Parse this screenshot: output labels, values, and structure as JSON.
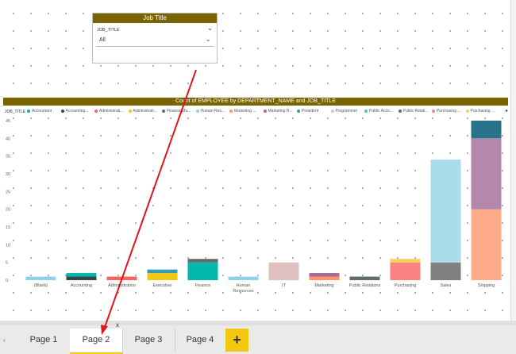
{
  "slicer": {
    "header": "Job Title",
    "field_label": "JOB_TITLE",
    "selected": "All"
  },
  "chart": {
    "header": "Count of EMPLOYEE by DEPARTMENT_NAME and JOB_TITLE",
    "legend_title": "JOB_TITLE",
    "legend_items": [
      {
        "label": "Accountant",
        "color": "#01b8aa"
      },
      {
        "label": "Accounting...",
        "color": "#374649"
      },
      {
        "label": "Administrati...",
        "color": "#fd625e"
      },
      {
        "label": "Administrati...",
        "color": "#f2c80f"
      },
      {
        "label": "Finance Ma...",
        "color": "#5f6b6d"
      },
      {
        "label": "Human Res...",
        "color": "#8ad4eb"
      },
      {
        "label": "Marketing ...",
        "color": "#fe9666"
      },
      {
        "label": "Marketing R...",
        "color": "#a66999"
      },
      {
        "label": "President",
        "color": "#3599b8"
      },
      {
        "label": "Programmer",
        "color": "#dfbfbf"
      },
      {
        "label": "Public Acco...",
        "color": "#4ac5bb"
      },
      {
        "label": "Public Relati...",
        "color": "#5f6b6d"
      },
      {
        "label": "Purchasing ...",
        "color": "#fb8281"
      },
      {
        "label": "Purchasing ...",
        "color": "#f4d25a"
      }
    ]
  },
  "chart_data": {
    "type": "bar",
    "stacked": true,
    "title": "Count of EMPLOYEE by DEPARTMENT_NAME and JOB_TITLE",
    "xlabel": "",
    "ylabel": "",
    "ylim": [
      0,
      45
    ],
    "yticks": [
      0,
      5,
      10,
      15,
      20,
      25,
      30,
      35,
      40,
      45
    ],
    "categories": [
      "(Blank)",
      "Accounting",
      "Administration",
      "Executive",
      "Finance",
      "Human Resources",
      "IT",
      "Marketing",
      "Public Relations",
      "Purchasing",
      "Sales",
      "Shipping"
    ],
    "stacks": [
      [
        {
          "v": 1,
          "c": "#8ad4eb"
        }
      ],
      [
        {
          "v": 1,
          "c": "#374649"
        },
        {
          "v": 1,
          "c": "#01b8aa"
        }
      ],
      [
        {
          "v": 1,
          "c": "#fd625e"
        }
      ],
      [
        {
          "v": 2,
          "c": "#f2c80f"
        },
        {
          "v": 1,
          "c": "#3599b8"
        }
      ],
      [
        {
          "v": 5,
          "c": "#01b8aa"
        },
        {
          "v": 1,
          "c": "#5f6b6d"
        }
      ],
      [
        {
          "v": 1,
          "c": "#8ad4eb"
        }
      ],
      [
        {
          "v": 5,
          "c": "#dfbfbf"
        }
      ],
      [
        {
          "v": 1,
          "c": "#fe9666"
        },
        {
          "v": 1,
          "c": "#a66999"
        }
      ],
      [
        {
          "v": 1,
          "c": "#5f6b6d"
        }
      ],
      [
        {
          "v": 5,
          "c": "#fb8281"
        },
        {
          "v": 1,
          "c": "#f4d25a"
        }
      ],
      [
        {
          "v": 5,
          "c": "#808080"
        },
        {
          "v": 29,
          "c": "#a8dcea"
        }
      ],
      [
        {
          "v": 20,
          "c": "#fdab89"
        },
        {
          "v": 20,
          "c": "#b687ac"
        },
        {
          "v": 5,
          "c": "#28738a"
        }
      ]
    ]
  },
  "tabs": {
    "items": [
      "Page 1",
      "Page 2",
      "Page 3",
      "Page 4"
    ],
    "active": "Page 2",
    "close_glyph": "x",
    "add_glyph": "+",
    "scroll_glyph": "‹"
  }
}
